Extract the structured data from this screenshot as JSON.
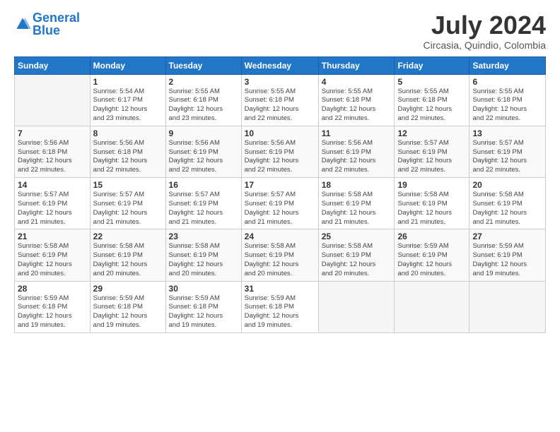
{
  "header": {
    "logo_general": "General",
    "logo_blue": "Blue",
    "month_title": "July 2024",
    "subtitle": "Circasia, Quindio, Colombia"
  },
  "calendar": {
    "weekdays": [
      "Sunday",
      "Monday",
      "Tuesday",
      "Wednesday",
      "Thursday",
      "Friday",
      "Saturday"
    ],
    "weeks": [
      [
        {
          "day": "",
          "info": ""
        },
        {
          "day": "1",
          "info": "Sunrise: 5:54 AM\nSunset: 6:17 PM\nDaylight: 12 hours\nand 23 minutes."
        },
        {
          "day": "2",
          "info": "Sunrise: 5:55 AM\nSunset: 6:18 PM\nDaylight: 12 hours\nand 23 minutes."
        },
        {
          "day": "3",
          "info": "Sunrise: 5:55 AM\nSunset: 6:18 PM\nDaylight: 12 hours\nand 22 minutes."
        },
        {
          "day": "4",
          "info": "Sunrise: 5:55 AM\nSunset: 6:18 PM\nDaylight: 12 hours\nand 22 minutes."
        },
        {
          "day": "5",
          "info": "Sunrise: 5:55 AM\nSunset: 6:18 PM\nDaylight: 12 hours\nand 22 minutes."
        },
        {
          "day": "6",
          "info": "Sunrise: 5:55 AM\nSunset: 6:18 PM\nDaylight: 12 hours\nand 22 minutes."
        }
      ],
      [
        {
          "day": "7",
          "info": "Sunrise: 5:56 AM\nSunset: 6:18 PM\nDaylight: 12 hours\nand 22 minutes."
        },
        {
          "day": "8",
          "info": "Sunrise: 5:56 AM\nSunset: 6:18 PM\nDaylight: 12 hours\nand 22 minutes."
        },
        {
          "day": "9",
          "info": "Sunrise: 5:56 AM\nSunset: 6:19 PM\nDaylight: 12 hours\nand 22 minutes."
        },
        {
          "day": "10",
          "info": "Sunrise: 5:56 AM\nSunset: 6:19 PM\nDaylight: 12 hours\nand 22 minutes."
        },
        {
          "day": "11",
          "info": "Sunrise: 5:56 AM\nSunset: 6:19 PM\nDaylight: 12 hours\nand 22 minutes."
        },
        {
          "day": "12",
          "info": "Sunrise: 5:57 AM\nSunset: 6:19 PM\nDaylight: 12 hours\nand 22 minutes."
        },
        {
          "day": "13",
          "info": "Sunrise: 5:57 AM\nSunset: 6:19 PM\nDaylight: 12 hours\nand 22 minutes."
        }
      ],
      [
        {
          "day": "14",
          "info": "Sunrise: 5:57 AM\nSunset: 6:19 PM\nDaylight: 12 hours\nand 21 minutes."
        },
        {
          "day": "15",
          "info": "Sunrise: 5:57 AM\nSunset: 6:19 PM\nDaylight: 12 hours\nand 21 minutes."
        },
        {
          "day": "16",
          "info": "Sunrise: 5:57 AM\nSunset: 6:19 PM\nDaylight: 12 hours\nand 21 minutes."
        },
        {
          "day": "17",
          "info": "Sunrise: 5:57 AM\nSunset: 6:19 PM\nDaylight: 12 hours\nand 21 minutes."
        },
        {
          "day": "18",
          "info": "Sunrise: 5:58 AM\nSunset: 6:19 PM\nDaylight: 12 hours\nand 21 minutes."
        },
        {
          "day": "19",
          "info": "Sunrise: 5:58 AM\nSunset: 6:19 PM\nDaylight: 12 hours\nand 21 minutes."
        },
        {
          "day": "20",
          "info": "Sunrise: 5:58 AM\nSunset: 6:19 PM\nDaylight: 12 hours\nand 21 minutes."
        }
      ],
      [
        {
          "day": "21",
          "info": "Sunrise: 5:58 AM\nSunset: 6:19 PM\nDaylight: 12 hours\nand 20 minutes."
        },
        {
          "day": "22",
          "info": "Sunrise: 5:58 AM\nSunset: 6:19 PM\nDaylight: 12 hours\nand 20 minutes."
        },
        {
          "day": "23",
          "info": "Sunrise: 5:58 AM\nSunset: 6:19 PM\nDaylight: 12 hours\nand 20 minutes."
        },
        {
          "day": "24",
          "info": "Sunrise: 5:58 AM\nSunset: 6:19 PM\nDaylight: 12 hours\nand 20 minutes."
        },
        {
          "day": "25",
          "info": "Sunrise: 5:58 AM\nSunset: 6:19 PM\nDaylight: 12 hours\nand 20 minutes."
        },
        {
          "day": "26",
          "info": "Sunrise: 5:59 AM\nSunset: 6:19 PM\nDaylight: 12 hours\nand 20 minutes."
        },
        {
          "day": "27",
          "info": "Sunrise: 5:59 AM\nSunset: 6:19 PM\nDaylight: 12 hours\nand 19 minutes."
        }
      ],
      [
        {
          "day": "28",
          "info": "Sunrise: 5:59 AM\nSunset: 6:18 PM\nDaylight: 12 hours\nand 19 minutes."
        },
        {
          "day": "29",
          "info": "Sunrise: 5:59 AM\nSunset: 6:18 PM\nDaylight: 12 hours\nand 19 minutes."
        },
        {
          "day": "30",
          "info": "Sunrise: 5:59 AM\nSunset: 6:18 PM\nDaylight: 12 hours\nand 19 minutes."
        },
        {
          "day": "31",
          "info": "Sunrise: 5:59 AM\nSunset: 6:18 PM\nDaylight: 12 hours\nand 19 minutes."
        },
        {
          "day": "",
          "info": ""
        },
        {
          "day": "",
          "info": ""
        },
        {
          "day": "",
          "info": ""
        }
      ]
    ]
  }
}
